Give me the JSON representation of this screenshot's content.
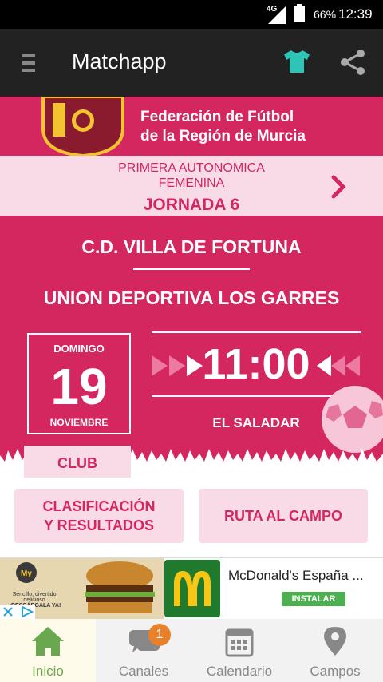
{
  "status_bar": {
    "network": "4G",
    "battery": "66%",
    "time": "12:39"
  },
  "app_bar": {
    "title": "Matchapp"
  },
  "federation": {
    "name_line1": "Federación de Fútbol",
    "name_line2": "de la Región de Murcia"
  },
  "league": {
    "competition_line1": "PRIMERA AUTONOMICA",
    "competition_line2": "FEMENINA",
    "matchday": "JORNADA 6"
  },
  "match": {
    "home_team": "C.D. VILLA DE FORTUNA",
    "away_team": "UNION DEPORTIVA LOS GARRES",
    "weekday": "DOMINGO",
    "day": "19",
    "month": "NOVIEMBRE",
    "time": "11:00",
    "venue": "EL SALADAR",
    "club_tab": "CLUB"
  },
  "actions": {
    "standings_line1": "CLASIFICACIÓN",
    "standings_line2": "Y RESULTADOS",
    "route": "RUTA AL CAMPO"
  },
  "ad": {
    "advertiser": "McDonald's España ...",
    "install": "INSTALAR",
    "image_tag_line1": "Sencillo, divertido, delicioso.",
    "image_tag_line2": "¡DESCÁRGALA YA!",
    "image_logo": "My"
  },
  "nav": {
    "items": [
      {
        "label": "Inicio",
        "icon": "home-icon"
      },
      {
        "label": "Canales",
        "icon": "chat-icon",
        "badge": "1"
      },
      {
        "label": "Calendario",
        "icon": "calendar-icon"
      },
      {
        "label": "Campos",
        "icon": "location-pin-icon"
      }
    ]
  },
  "colors": {
    "primary": "#d4265f",
    "light_pink": "#f9dbe7",
    "appbar": "#222222",
    "teal": "#2ec4b6",
    "active_nav": "#6aa84f"
  }
}
